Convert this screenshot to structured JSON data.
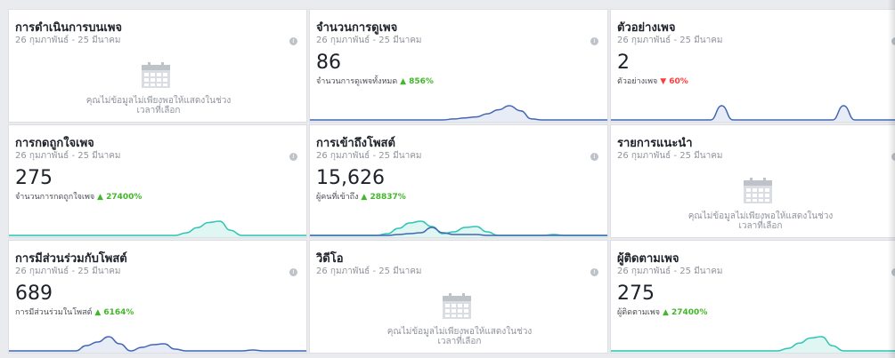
{
  "cards": [
    {
      "id": "page-activity",
      "title": "การดำเนินการบนเพจ",
      "date": "26 กุมภาพันธ์ - 25 มีนาคม",
      "nodata": true,
      "nodata_text_1": "คุณไม่ข้อมูลไม่เพียงพอให้แสดงในช่วง",
      "nodata_text_2": "เวลาที่เลือก"
    },
    {
      "id": "page-views",
      "title": "จำนวนการดูเพจ",
      "date": "26 กุมภาพันธ์ - 25 มีนาคม",
      "value": "86",
      "sub_label": "จำนวนการดูเพจทั้งหมด",
      "change": "▲ 856%",
      "change_dir": "up",
      "chart_data": {
        "type": "line",
        "values": [
          0,
          0,
          0,
          0,
          0,
          0,
          0,
          0,
          0,
          0,
          0,
          0,
          0,
          1,
          2,
          3,
          6,
          10,
          14,
          9,
          1,
          0,
          0,
          0,
          0,
          0,
          0,
          0
        ]
      }
    },
    {
      "id": "page-previews",
      "title": "ตัวอย่างเพจ",
      "date": "26 กุมภาพันธ์ - 25 มีนาคม",
      "value": "2",
      "sub_label": "ตัวอย่างเพจ",
      "change": "▼ 60%",
      "change_dir": "down",
      "chart_data": {
        "type": "line",
        "values": [
          0,
          0,
          0,
          0,
          0,
          0,
          0,
          0,
          0,
          0,
          1,
          0,
          0,
          0,
          0,
          0,
          0,
          0,
          0,
          0,
          0,
          1,
          0,
          0,
          0,
          0,
          0,
          0
        ]
      }
    },
    {
      "id": "page-likes",
      "title": "การกดถูกใจเพจ",
      "date": "26 กุมภาพันธ์ - 25 มีนาคม",
      "value": "275",
      "sub_label": "จำนวนการกดถูกใจเพจ",
      "change": "▲ 27400%",
      "change_dir": "up",
      "chart_data": {
        "type": "area",
        "values": [
          0,
          0,
          0,
          0,
          0,
          0,
          0,
          0,
          0,
          0,
          0,
          0,
          0,
          0,
          0,
          0,
          2,
          6,
          10,
          11,
          4,
          0,
          0,
          0,
          0,
          0,
          0,
          0
        ]
      }
    },
    {
      "id": "post-reach",
      "title": "การเข้าถึงโพสต์",
      "date": "26 กุมภาพันธ์ - 25 มีนาคม",
      "value": "15,626",
      "sub_label": "ผู้คนที่เข้าถึง",
      "change": "▲ 28837%",
      "change_dir": "up",
      "chart_data": {
        "type": "area",
        "values": [
          0,
          0,
          0,
          0,
          0,
          0,
          0,
          2,
          8,
          14,
          16,
          10,
          2,
          4,
          9,
          10,
          4,
          0,
          0,
          0,
          0,
          0,
          1,
          0,
          0,
          0,
          0,
          0
        ],
        "values2": [
          0,
          0,
          0,
          0,
          0,
          0,
          0,
          0,
          1,
          2,
          3,
          9,
          3,
          1,
          1,
          1,
          0,
          0,
          0,
          0,
          0,
          0,
          0,
          0,
          0,
          0,
          0,
          0
        ]
      }
    },
    {
      "id": "recommendations",
      "title": "รายการแนะนำ",
      "date": "26 กุมภาพันธ์ - 25 มีนาคม",
      "nodata": true,
      "nodata_text_1": "คุณไม่ข้อมูลไม่เพียงพอให้แสดงในช่วง",
      "nodata_text_2": "เวลาที่เลือก"
    },
    {
      "id": "post-engagement",
      "title": "การมีส่วนร่วมกับโพสต์",
      "date": "26 กุมภาพันธ์ - 25 มีนาคม",
      "value": "689",
      "sub_label": "การมีส่วนร่วมในโพสต์",
      "change": "▲ 6164%",
      "change_dir": "up",
      "chart_data": {
        "type": "area",
        "values": [
          0,
          0,
          0,
          0,
          0,
          0,
          0,
          6,
          10,
          16,
          8,
          0,
          4,
          7,
          8,
          2,
          0,
          0,
          0,
          0,
          0,
          0,
          1,
          0,
          0,
          0,
          0,
          0
        ]
      }
    },
    {
      "id": "videos",
      "title": "วิดีโอ",
      "date": "26 กุมภาพันธ์ - 25 มีนาคม",
      "nodata": true,
      "nodata_text_1": "คุณไม่ข้อมูลไม่เพียงพอให้แสดงในช่วง",
      "nodata_text_2": "เวลาที่เลือก"
    },
    {
      "id": "page-followers",
      "title": "ผู้ติดตามเพจ",
      "date": "26 กุมภาพันธ์ - 25 มีนาคม",
      "value": "275",
      "sub_label": "ผู้ติดตามเพจ",
      "change": "▲ 27400%",
      "change_dir": "up",
      "chart_data": {
        "type": "area",
        "values": [
          0,
          0,
          0,
          0,
          0,
          0,
          0,
          0,
          0,
          0,
          0,
          0,
          0,
          0,
          0,
          0,
          2,
          6,
          10,
          11,
          4,
          0,
          0,
          0,
          0,
          0,
          0,
          0
        ]
      }
    }
  ],
  "colors": {
    "line_blue": "#4267b2",
    "fill_blue": "#e7ecf6",
    "line_teal": "#2ec4b6",
    "fill_teal": "#e0f6f2",
    "up_green": "#42b72a",
    "down_red": "#fa3e3e"
  }
}
